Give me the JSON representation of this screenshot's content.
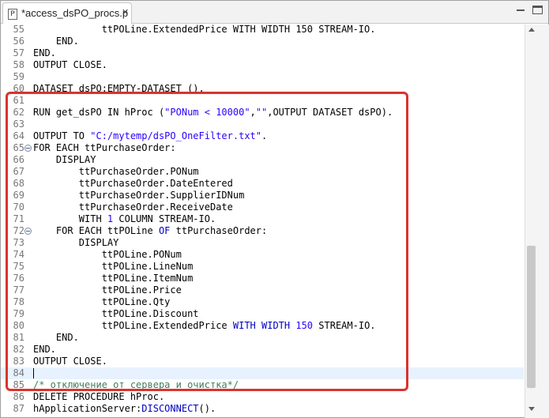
{
  "tab": {
    "label": "*access_dsPO_procs.p",
    "icon": "P",
    "close": "✕"
  },
  "colors": {
    "highlight": "#d9342b",
    "current_line": "#e8f2fe",
    "string": "#2a00ff",
    "comment": "#3f7f5f",
    "keyword_blue": "#0000c0"
  },
  "lines": [
    {
      "n": "55",
      "t": [
        [
          "plain",
          "            ttPOLine.ExtendedPrice WITH WIDTH 150 STREAM-IO."
        ]
      ]
    },
    {
      "n": "56",
      "t": [
        [
          "plain",
          "    END."
        ]
      ]
    },
    {
      "n": "57",
      "t": [
        [
          "plain",
          "END."
        ]
      ]
    },
    {
      "n": "58",
      "t": [
        [
          "plain",
          "OUTPUT CLOSE."
        ]
      ]
    },
    {
      "n": "59",
      "t": [
        [
          "plain",
          ""
        ]
      ]
    },
    {
      "n": "60",
      "t": [
        [
          "plain",
          "DATASET dsPO:EMPTY-DATASET ()."
        ]
      ]
    },
    {
      "n": "61",
      "t": [
        [
          "plain",
          ""
        ]
      ]
    },
    {
      "n": "62",
      "t": [
        [
          "plain",
          "RUN get_dsPO IN hProc ("
        ],
        [
          "str",
          "\"PONum < 10000\""
        ],
        [
          "plain",
          ","
        ],
        [
          "str",
          "\"\""
        ],
        [
          "plain",
          ",OUTPUT DATASET dsPO)."
        ]
      ]
    },
    {
      "n": "63",
      "t": [
        [
          "plain",
          ""
        ]
      ]
    },
    {
      "n": "64",
      "t": [
        [
          "plain",
          "OUTPUT TO "
        ],
        [
          "str",
          "\"C:/mytemp/dsPO_OneFilter.txt\""
        ],
        [
          "plain",
          "."
        ]
      ]
    },
    {
      "n": "65",
      "fold": true,
      "t": [
        [
          "plain",
          "FOR EACH ttPurchaseOrder:"
        ]
      ]
    },
    {
      "n": "66",
      "t": [
        [
          "plain",
          "    DISPLAY"
        ]
      ]
    },
    {
      "n": "67",
      "t": [
        [
          "plain",
          "        ttPurchaseOrder.PONum"
        ]
      ]
    },
    {
      "n": "68",
      "t": [
        [
          "plain",
          "        ttPurchaseOrder.DateEntered"
        ]
      ]
    },
    {
      "n": "69",
      "t": [
        [
          "plain",
          "        ttPurchaseOrder.SupplierIDNum"
        ]
      ]
    },
    {
      "n": "70",
      "t": [
        [
          "plain",
          "        ttPurchaseOrder.ReceiveDate"
        ]
      ]
    },
    {
      "n": "71",
      "t": [
        [
          "plain",
          "        WITH "
        ],
        [
          "num",
          "1"
        ],
        [
          "plain",
          " COLUMN STREAM-IO."
        ]
      ]
    },
    {
      "n": "72",
      "fold": true,
      "t": [
        [
          "plain",
          "    FOR EACH ttPOLine "
        ],
        [
          "blue",
          "OF"
        ],
        [
          "plain",
          " ttPurchaseOrder:"
        ]
      ]
    },
    {
      "n": "73",
      "t": [
        [
          "plain",
          "        DISPLAY"
        ]
      ]
    },
    {
      "n": "74",
      "t": [
        [
          "plain",
          "            ttPOLine.PONum"
        ]
      ]
    },
    {
      "n": "75",
      "t": [
        [
          "plain",
          "            ttPOLine.LineNum"
        ]
      ]
    },
    {
      "n": "76",
      "t": [
        [
          "plain",
          "            ttPOLine.ItemNum"
        ]
      ]
    },
    {
      "n": "77",
      "t": [
        [
          "plain",
          "            ttPOLine.Price"
        ]
      ]
    },
    {
      "n": "78",
      "t": [
        [
          "plain",
          "            ttPOLine.Qty"
        ]
      ]
    },
    {
      "n": "79",
      "t": [
        [
          "plain",
          "            ttPOLine.Discount"
        ]
      ]
    },
    {
      "n": "80",
      "t": [
        [
          "plain",
          "            ttPOLine.ExtendedPrice "
        ],
        [
          "blue",
          "WITH WIDTH"
        ],
        [
          "plain",
          " "
        ],
        [
          "num",
          "150"
        ],
        [
          "plain",
          " STREAM-IO."
        ]
      ]
    },
    {
      "n": "81",
      "t": [
        [
          "plain",
          "    END."
        ]
      ]
    },
    {
      "n": "82",
      "t": [
        [
          "plain",
          "END."
        ]
      ]
    },
    {
      "n": "83",
      "t": [
        [
          "plain",
          "OUTPUT CLOSE."
        ]
      ]
    },
    {
      "n": "84",
      "current": true,
      "t": [
        [
          "plain",
          ""
        ]
      ]
    },
    {
      "n": "85",
      "t": [
        [
          "cm",
          "/* отключение от сервера и очистка*/"
        ]
      ]
    },
    {
      "n": "86",
      "t": [
        [
          "plain",
          "DELETE PROCEDURE hProc."
        ]
      ]
    },
    {
      "n": "87",
      "t": [
        [
          "plain",
          "hApplicationServer:"
        ],
        [
          "blue",
          "DISCONNECT"
        ],
        [
          "plain",
          "()."
        ]
      ]
    }
  ]
}
